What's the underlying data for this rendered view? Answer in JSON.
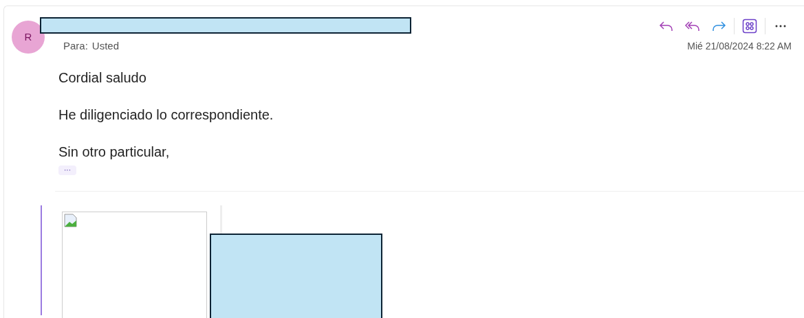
{
  "sender": {
    "initial": "R",
    "color": "#e8a5d4"
  },
  "recipient_label": "Para:",
  "recipient": "Usted",
  "date": "Mié 21/08/2024 8:22 AM",
  "body": [
    "Cordial saludo",
    "He diligenciado lo correspondiente.",
    "Sin otro particular,"
  ],
  "show_more": "···"
}
